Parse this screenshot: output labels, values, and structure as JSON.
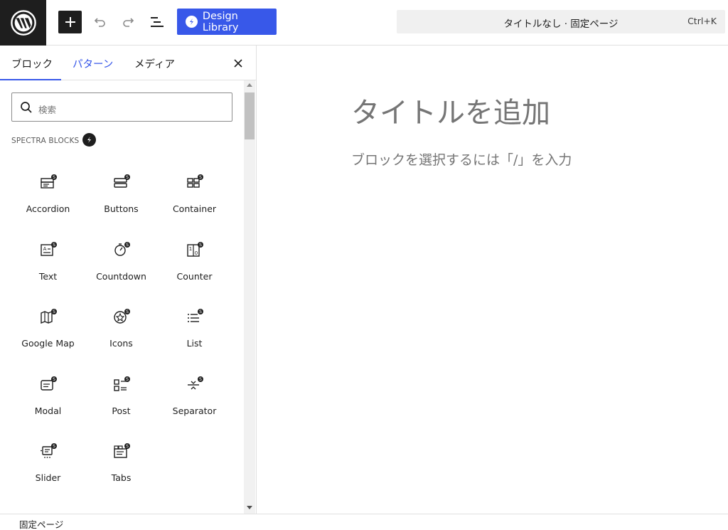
{
  "topbar": {
    "logo_icon": "wordpress-logo-icon",
    "add_icon": "plus-icon",
    "undo_icon": "undo-icon",
    "redo_icon": "redo-icon",
    "list_view_icon": "list-view-icon",
    "design_library_label": "Design Library",
    "document_title": "タイトルなし · 固定ページ",
    "shortcut": "Ctrl+K",
    "accent_color": "#3858e9"
  },
  "sidebar": {
    "tabs": [
      {
        "label": "ブロック",
        "active": true
      },
      {
        "label": "パターン",
        "active": false
      },
      {
        "label": "メディア",
        "active": false
      }
    ],
    "search_placeholder": "検索",
    "category_title": "SPECTRA BLOCKS",
    "blocks": [
      {
        "label": "Accordion",
        "icon": "accordion-icon"
      },
      {
        "label": "Buttons",
        "icon": "buttons-icon"
      },
      {
        "label": "Container",
        "icon": "container-icon"
      },
      {
        "label": "Text",
        "icon": "text-icon"
      },
      {
        "label": "Countdown",
        "icon": "countdown-icon"
      },
      {
        "label": "Counter",
        "icon": "counter-icon"
      },
      {
        "label": "Google Map",
        "icon": "map-icon"
      },
      {
        "label": "Icons",
        "icon": "icons-icon"
      },
      {
        "label": "List",
        "icon": "list-icon"
      },
      {
        "label": "Modal",
        "icon": "modal-icon"
      },
      {
        "label": "Post",
        "icon": "post-icon"
      },
      {
        "label": "Separator",
        "icon": "separator-icon"
      },
      {
        "label": "Slider",
        "icon": "slider-icon"
      },
      {
        "label": "Tabs",
        "icon": "tabs-icon"
      }
    ]
  },
  "editor": {
    "title_placeholder": "タイトルを追加",
    "block_hint": "ブロックを選択するには「/」を入力"
  },
  "footer": {
    "breadcrumb": "固定ページ"
  }
}
